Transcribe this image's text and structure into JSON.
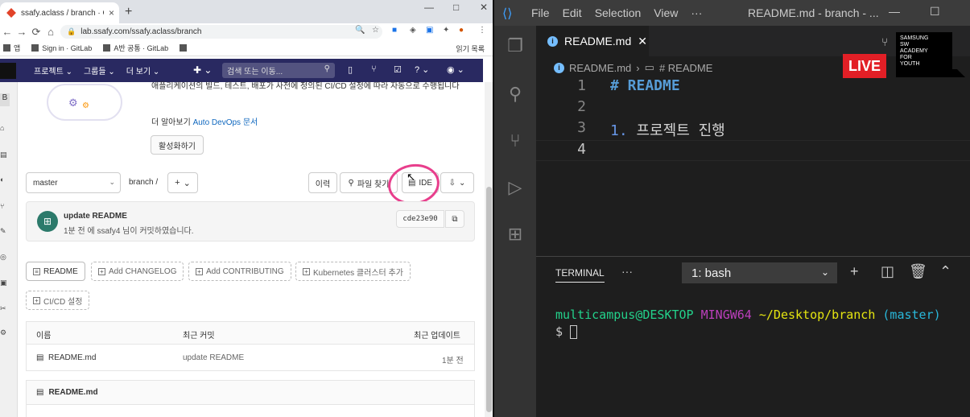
{
  "browser": {
    "tab_title": "ssafy.aclass / branch · GitLab",
    "tab_close": "×",
    "new_tab": "+",
    "window_controls": [
      "—",
      "□",
      "✕"
    ],
    "nav": {
      "back": "←",
      "forward": "→",
      "reload": "⟳",
      "home": "⌂"
    },
    "url": "lab.ssafy.com/ssafy.aclass/branch",
    "bookmarks": [
      "앱",
      "Sign in · GitLab",
      "A반 공통 · GitLab"
    ],
    "reading_list": "읽기 목록"
  },
  "gitlab_nav": {
    "menu": [
      "프로젝트 ⌄",
      "그룹들 ⌄",
      "더 보기 ⌄"
    ],
    "search_placeholder": "검색 또는 이동..."
  },
  "devops": {
    "description": "애플리케이션의 빌드, 테스트, 배포가 사전에 정의된 CI/CD 설정에 따라 자동으로 수행됩니다",
    "more_prefix": "더 알아보기 ",
    "more_link": "Auto DevOps 문서",
    "activate_button": "활성화하기"
  },
  "repo_toolbar": {
    "branch": "master",
    "path": "branch  /",
    "add": "+",
    "history": "이력",
    "find_file": "파일 찾기",
    "ide": "IDE"
  },
  "commit": {
    "title": "update README",
    "meta": "1분 전 에 ssafy4 님이 커밋하였습니다.",
    "sha": "cde23e90"
  },
  "quick_buttons": [
    "README",
    "Add CHANGELOG",
    "Add CONTRIBUTING",
    "Kubernetes 클러스터 추가",
    "CI/CD 설정"
  ],
  "files": {
    "headers": [
      "이름",
      "최근 커밋",
      "최근 업데이트"
    ],
    "rows": [
      {
        "name": "README.md",
        "commit": "update README",
        "updated": "1분 전"
      }
    ]
  },
  "readme_heading": "README.md",
  "vscode": {
    "menu": [
      "File",
      "Edit",
      "Selection",
      "View",
      "···"
    ],
    "title": "README.md - branch - ...",
    "tab_label": "README.md",
    "tab_close": "✕",
    "breadcrumb_file": "README.md",
    "breadcrumb_symbol": "# README",
    "lines": [
      {
        "n": "1",
        "text": "# README"
      },
      {
        "n": "2",
        "text": ""
      },
      {
        "n": "3",
        "num": "1.",
        "text": " 프로젝트 진행"
      },
      {
        "n": "4",
        "text": ""
      }
    ],
    "live": "LIVE",
    "ssafy_logo": [
      "SAMSUNG",
      "SW",
      "ACADEMY",
      "FOR",
      "YOUTH"
    ],
    "terminal": {
      "tab": "TERMINAL",
      "shell": "1: bash",
      "user": "multicampus@DESKTOP",
      "host": "MINGW64",
      "path": "~/Desktop/branch",
      "branch": "(master)",
      "prompt": "$ "
    }
  }
}
